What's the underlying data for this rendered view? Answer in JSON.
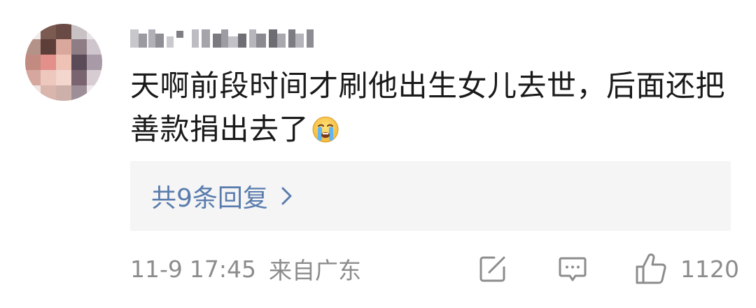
{
  "comment": {
    "username": "",
    "text": "天啊前段时间才刷他出生女儿去世，后面还把善款捐出去了",
    "emoji": "crying-face-emoji"
  },
  "replies": {
    "label": "共9条回复"
  },
  "meta": {
    "date": "11-9",
    "time": "17:45",
    "location": "来自广东"
  },
  "actions": {
    "share_icon": "share-edit-icon",
    "comment_icon": "comment-bubble-icon",
    "like_icon": "thumbs-up-icon",
    "like_count": "1120"
  },
  "colors": {
    "link": "#5a7cad",
    "muted": "#8c8c8c",
    "text": "#1a1a1a",
    "reply_bg": "#f5f5f5"
  }
}
